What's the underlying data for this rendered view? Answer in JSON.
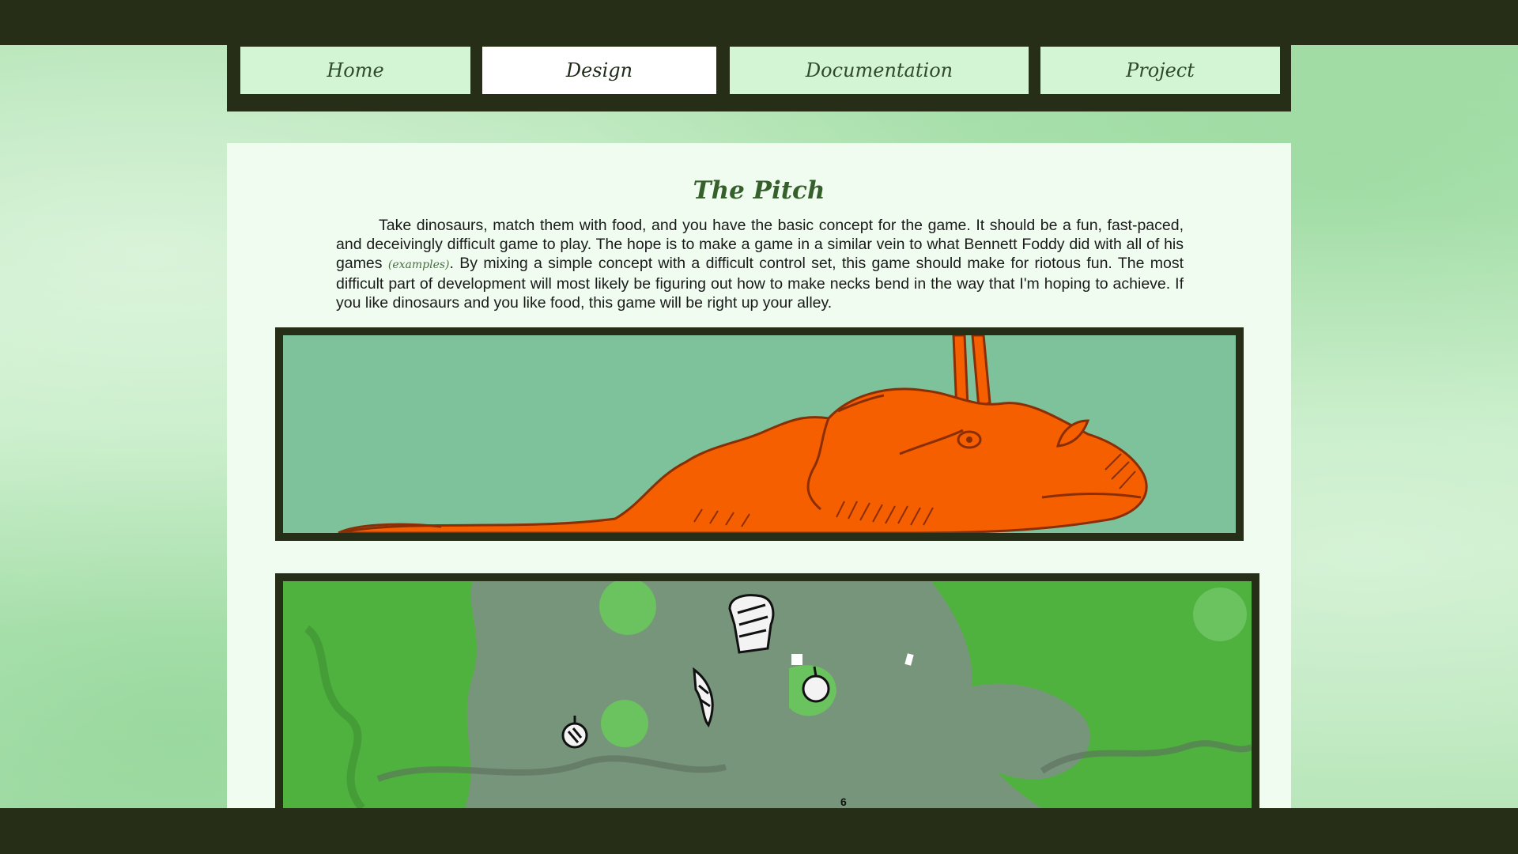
{
  "nav": {
    "tabs": [
      {
        "label": "Home",
        "active": false
      },
      {
        "label": "Design",
        "active": true
      },
      {
        "label": "Documentation",
        "active": false
      },
      {
        "label": "Project",
        "active": false
      }
    ]
  },
  "main": {
    "title": "The Pitch",
    "paragraph_before": "Take dinosaurs, match them with food, and you have the basic concept for the game. It should be a fun, fast-paced, and deceivingly difficult game to play. The hope is to make a game in a similar vein to what Bennett Foddy did with all of his games ",
    "examples_link": "(examples)",
    "paragraph_after": ". By mixing a simple concept with a difficult control set, this game should make for riotous fun. The most difficult part of development will most likely be figuring out how to make necks bend in the way that I'm hoping to achieve. If you like dinosaurs and you like food, this game will be right up your alley."
  },
  "images": {
    "dino_icon": "triceratops-illustration",
    "game_icon": "game-screenshot",
    "game_counter": "6"
  },
  "colors": {
    "dark": "#262e18",
    "tab": "#d3f5d3",
    "tab_active": "#ffffff",
    "content_bg": "#f0fcf0",
    "title": "#35602c",
    "dino_orange": "#f55f00",
    "teal_bg": "#7dc29a"
  }
}
